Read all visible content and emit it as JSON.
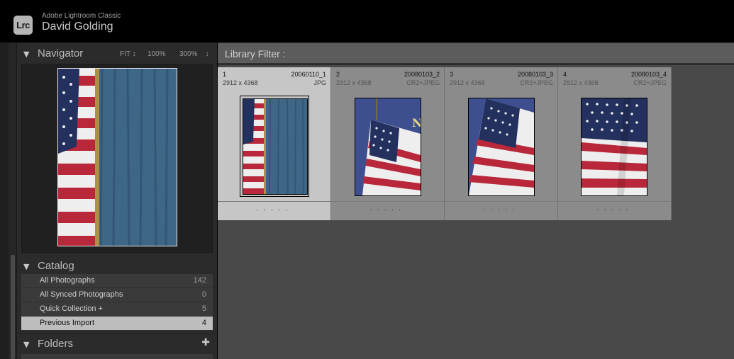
{
  "app": {
    "logo_text": "Lrc",
    "name": "Adobe Lightroom Classic",
    "user": "David Golding"
  },
  "navigator": {
    "title": "Navigator",
    "collapse_icon": "triangle-down-icon",
    "zoom_options": [
      "FIT",
      "100%",
      "300%"
    ],
    "fit_suffix": "↕",
    "zoom_menu_icon": "↕"
  },
  "catalog": {
    "title": "Catalog",
    "items": [
      {
        "label": "All Photographs",
        "count": "142"
      },
      {
        "label": "All Synced Photographs",
        "count": "0"
      },
      {
        "label": "Quick Collection  +",
        "count": "5"
      },
      {
        "label": "Previous Import",
        "count": "4",
        "selected": true
      }
    ]
  },
  "folders": {
    "title": "Folders",
    "add_icon": "plus-icon"
  },
  "library_filter": {
    "label": "Library Filter :"
  },
  "grid": {
    "cells": [
      {
        "index": "1",
        "filename": "20060110_1",
        "dims": "2912 x 4368",
        "type": "JPG",
        "rating_dots": "·····",
        "selected": true
      },
      {
        "index": "2",
        "filename": "20080103_2",
        "dims": "2912 x 4368",
        "type": "CR2+JPEG",
        "rating_dots": "·····",
        "selected": false
      },
      {
        "index": "3",
        "filename": "20080103_3",
        "dims": "2912 x 4368",
        "type": "CR2+JPEG",
        "rating_dots": "·····",
        "selected": false
      },
      {
        "index": "4",
        "filename": "20080103_4",
        "dims": "2912 x 4368",
        "type": "CR2+JPEG",
        "rating_dots": "·····",
        "selected": false
      }
    ]
  },
  "colors": {
    "flag_red": "#b8283a",
    "flag_white": "#eeeeee",
    "flag_blue": "#24305e",
    "curtain_blue": "#3e6687",
    "backdrop_blue": "#3d4f8f"
  }
}
